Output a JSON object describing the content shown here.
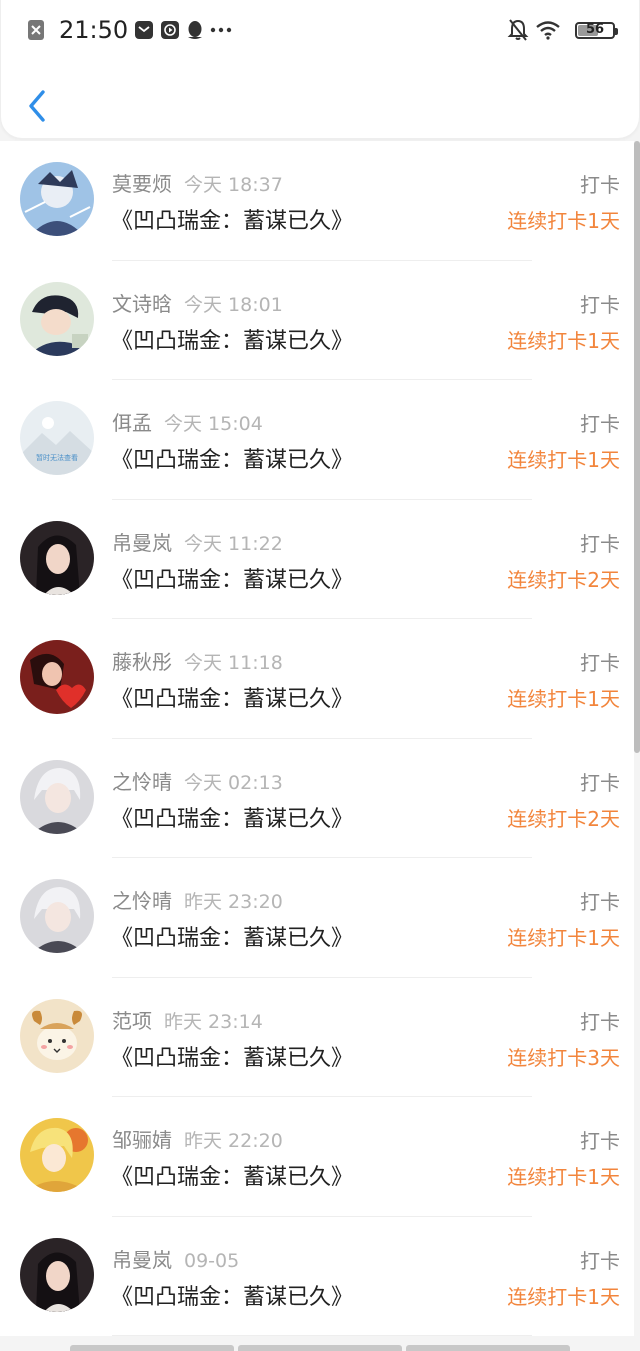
{
  "status_bar": {
    "time": "21:50",
    "battery": "56",
    "icons": [
      "close-box-icon",
      "mail-icon",
      "video-icon",
      "qq-penguin-icon",
      "more-dots-icon",
      "bell-off-icon",
      "wifi-icon",
      "battery-icon"
    ]
  },
  "header": {
    "back_icon": "chevron-left-icon"
  },
  "colors": {
    "accent": "#2f8ee8",
    "streak": "#f2853c",
    "secondary": "#8a8a8a",
    "muted": "#b5b5b5"
  },
  "items": [
    {
      "name": "莫要烦",
      "time": "今天 18:37",
      "title": "《凹凸瑞金：蓄谋已久》",
      "tag": "打卡",
      "streak": "连续打卡1天",
      "avatar": "anime-boy-avatar"
    },
    {
      "name": "文诗晗",
      "time": "今天 18:01",
      "title": "《凹凸瑞金：蓄谋已久》",
      "tag": "打卡",
      "streak": "连续打卡1天",
      "avatar": "sleeping-girl-avatar"
    },
    {
      "name": "佴孟",
      "time": "今天 15:04",
      "title": "《凹凸瑞金：蓄谋已久》",
      "tag": "打卡",
      "streak": "连续打卡1天",
      "avatar": "placeholder-avatar",
      "avatar_text": "暂时无法查看"
    },
    {
      "name": "帛曼岚",
      "time": "今天 11:22",
      "title": "《凹凸瑞金：蓄谋已久》",
      "tag": "打卡",
      "streak": "连续打卡2天",
      "avatar": "dark-hair-girl-avatar"
    },
    {
      "name": "藤秋彤",
      "time": "今天 11:18",
      "title": "《凹凸瑞金：蓄谋已久》",
      "tag": "打卡",
      "streak": "连续打卡1天",
      "avatar": "red-heart-avatar"
    },
    {
      "name": "之怜晴",
      "time": "今天 02:13",
      "title": "《凹凸瑞金：蓄谋已久》",
      "tag": "打卡",
      "streak": "连续打卡2天",
      "avatar": "white-hair-anime-avatar"
    },
    {
      "name": "之怜晴",
      "time": "昨天 23:20",
      "title": "《凹凸瑞金：蓄谋已久》",
      "tag": "打卡",
      "streak": "连续打卡1天",
      "avatar": "white-hair-anime-avatar"
    },
    {
      "name": "范项",
      "time": "昨天 23:14",
      "title": "《凹凸瑞金：蓄谋已久》",
      "tag": "打卡",
      "streak": "连续打卡3天",
      "avatar": "cartoon-sheep-avatar"
    },
    {
      "name": "邹骊婧",
      "time": "昨天 22:20",
      "title": "《凹凸瑞金：蓄谋已久》",
      "tag": "打卡",
      "streak": "连续打卡1天",
      "avatar": "yellow-anime-avatar"
    },
    {
      "name": "帛曼岚",
      "time": "09-05",
      "title": "《凹凸瑞金：蓄谋已久》",
      "tag": "打卡",
      "streak": "连续打卡1天",
      "avatar": "dark-hair-girl-avatar"
    }
  ]
}
